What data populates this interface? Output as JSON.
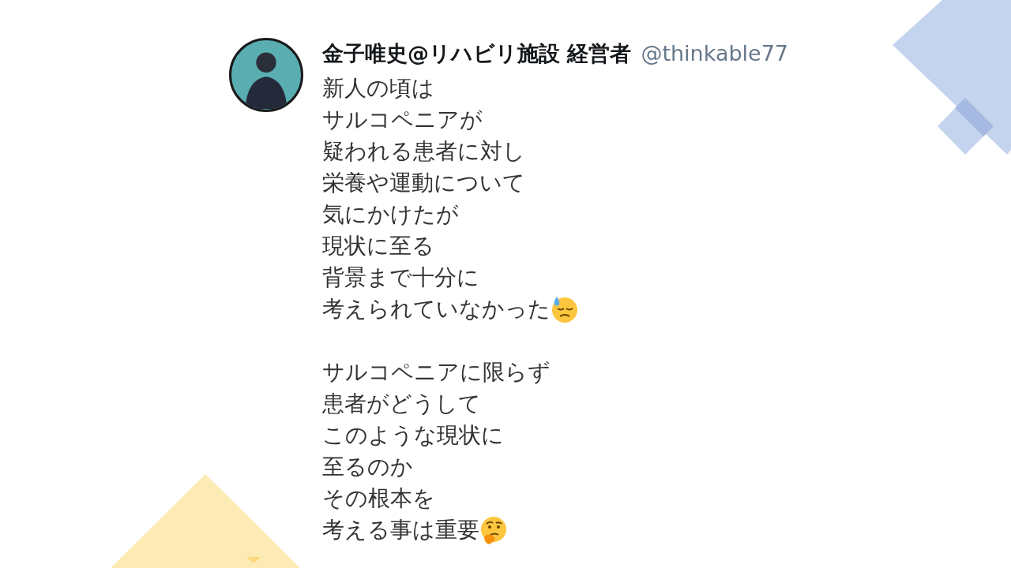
{
  "tweet": {
    "author": {
      "name": "金子唯史@リハビリ施設 経営者",
      "handle": "@thinkable77"
    },
    "paragraphs": [
      [
        {
          "kind": "plain",
          "text": "新人の頃は"
        },
        {
          "kind": "plain",
          "text": "サルコペニアが"
        },
        {
          "kind": "plain",
          "text": "疑われる患者に対し"
        },
        {
          "kind": "plain",
          "text": "栄養や運動について"
        },
        {
          "kind": "plain",
          "text": "気にかけたが"
        },
        {
          "kind": "plain",
          "text": "現状に至る"
        },
        {
          "kind": "plain",
          "text": "背景まで十分に"
        },
        {
          "kind": "sweat",
          "text": "考えられていなかった"
        }
      ],
      [
        {
          "kind": "plain",
          "text": "サルコペニアに限らず"
        },
        {
          "kind": "plain",
          "text": "患者がどうして"
        },
        {
          "kind": "plain",
          "text": "このような現状に"
        },
        {
          "kind": "plain",
          "text": "至るのか"
        },
        {
          "kind": "plain",
          "text": "その根本を"
        },
        {
          "kind": "thinking",
          "text": "考える事は重要"
        }
      ]
    ]
  }
}
